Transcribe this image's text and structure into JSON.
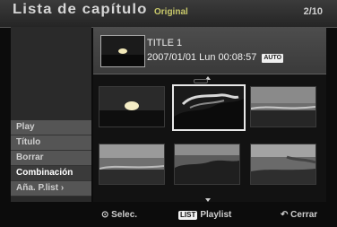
{
  "header": {
    "title": "Lista de capítulo",
    "mode": "Original",
    "counter": "2/10"
  },
  "sidebar": {
    "items": [
      {
        "label": "Play"
      },
      {
        "label": "Título"
      },
      {
        "label": "Borrar"
      },
      {
        "label": "Combinación"
      },
      {
        "label": "Aña. P.list ›"
      }
    ]
  },
  "info": {
    "title": "TITLE 1",
    "date": "2007/01/01  Lun  00:08:57",
    "badge": "AUTO"
  },
  "grid": {
    "selected_index": 1,
    "thumbnails": [
      {
        "name": "sun-over-sea"
      },
      {
        "name": "cloudy-sky"
      },
      {
        "name": "sunset-horizon"
      },
      {
        "name": "shoreline-evening"
      },
      {
        "name": "dusk-hills"
      },
      {
        "name": "coast-cliffs"
      }
    ]
  },
  "footer": {
    "select": "⊙ Selec.",
    "playlist_badge": "LIST",
    "playlist": "Playlist",
    "close": "↶ Cerrar"
  }
}
